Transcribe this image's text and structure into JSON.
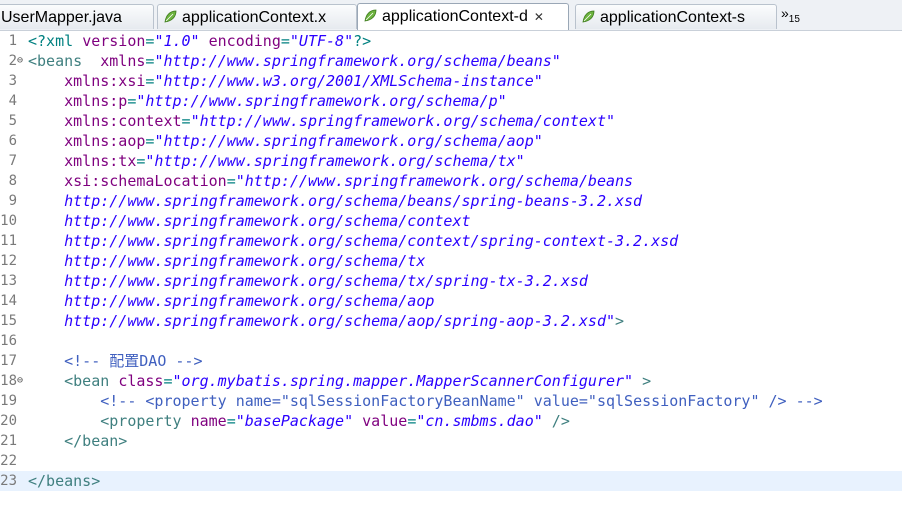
{
  "tabs": [
    {
      "label": "UserMapper.java",
      "icon": "java-file-icon",
      "active": false
    },
    {
      "label": "applicationContext.x",
      "icon": "spring-leaf-icon",
      "active": false
    },
    {
      "label": "applicationContext-d",
      "icon": "spring-leaf-icon",
      "active": true,
      "close": "✕"
    },
    {
      "label": "applicationContext-s",
      "icon": "spring-leaf-icon",
      "active": false
    }
  ],
  "overflow": {
    "glyph": "»",
    "count": "15"
  },
  "lines": [
    {
      "n": "1",
      "fold": "",
      "segs": [
        [
          "p",
          "<?xml "
        ],
        [
          "a",
          "version"
        ],
        [
          "p",
          "="
        ],
        [
          "v",
          "\"1.0\""
        ],
        [
          "p",
          " "
        ],
        [
          "a",
          "encoding"
        ],
        [
          "p",
          "="
        ],
        [
          "v",
          "\"UTF-8\""
        ],
        [
          "p",
          "?>"
        ]
      ]
    },
    {
      "n": "2",
      "fold": "⊖",
      "segs": [
        [
          "t",
          "<beans"
        ],
        [
          "p",
          "  "
        ],
        [
          "a",
          "xmlns"
        ],
        [
          "p",
          "="
        ],
        [
          "v",
          "\"http://www.springframework.org/schema/beans\""
        ]
      ]
    },
    {
      "n": "3",
      "fold": "",
      "segs": [
        [
          "p",
          "    "
        ],
        [
          "a",
          "xmlns:xsi"
        ],
        [
          "p",
          "="
        ],
        [
          "v",
          "\"http://www.w3.org/2001/XMLSchema-instance\""
        ]
      ]
    },
    {
      "n": "4",
      "fold": "",
      "segs": [
        [
          "p",
          "    "
        ],
        [
          "a",
          "xmlns:p"
        ],
        [
          "p",
          "="
        ],
        [
          "v",
          "\"http://www.springframework.org/schema/p\""
        ]
      ]
    },
    {
      "n": "5",
      "fold": "",
      "segs": [
        [
          "p",
          "    "
        ],
        [
          "a",
          "xmlns:context"
        ],
        [
          "p",
          "="
        ],
        [
          "v",
          "\"http://www.springframework.org/schema/context\""
        ]
      ]
    },
    {
      "n": "6",
      "fold": "",
      "segs": [
        [
          "p",
          "    "
        ],
        [
          "a",
          "xmlns:aop"
        ],
        [
          "p",
          "="
        ],
        [
          "v",
          "\"http://www.springframework.org/schema/aop\""
        ]
      ]
    },
    {
      "n": "7",
      "fold": "",
      "segs": [
        [
          "p",
          "    "
        ],
        [
          "a",
          "xmlns:tx"
        ],
        [
          "p",
          "="
        ],
        [
          "v",
          "\"http://www.springframework.org/schema/tx\""
        ]
      ]
    },
    {
      "n": "8",
      "fold": "",
      "segs": [
        [
          "p",
          "    "
        ],
        [
          "a",
          "xsi:schemaLocation"
        ],
        [
          "p",
          "="
        ],
        [
          "v",
          "\"http://www.springframework.org/schema/beans"
        ]
      ]
    },
    {
      "n": "9",
      "fold": "",
      "segs": [
        [
          "v",
          "    http://www.springframework.org/schema/beans/spring-beans-3.2.xsd"
        ]
      ]
    },
    {
      "n": "10",
      "fold": "",
      "segs": [
        [
          "v",
          "    http://www.springframework.org/schema/context"
        ]
      ]
    },
    {
      "n": "11",
      "fold": "",
      "segs": [
        [
          "v",
          "    http://www.springframework.org/schema/context/spring-context-3.2.xsd"
        ]
      ]
    },
    {
      "n": "12",
      "fold": "",
      "segs": [
        [
          "v",
          "    http://www.springframework.org/schema/tx"
        ]
      ]
    },
    {
      "n": "13",
      "fold": "",
      "segs": [
        [
          "v",
          "    http://www.springframework.org/schema/tx/spring-tx-3.2.xsd"
        ]
      ]
    },
    {
      "n": "14",
      "fold": "",
      "segs": [
        [
          "v",
          "    http://www.springframework.org/schema/aop"
        ]
      ]
    },
    {
      "n": "15",
      "fold": "",
      "segs": [
        [
          "v",
          "    http://www.springframework.org/schema/aop/spring-aop-3.2.xsd\""
        ],
        [
          "t",
          ">"
        ]
      ]
    },
    {
      "n": "16",
      "fold": "",
      "segs": []
    },
    {
      "n": "17",
      "fold": "",
      "segs": [
        [
          "p",
          "    "
        ],
        [
          "c",
          "<!-- 配置DAO -->"
        ]
      ]
    },
    {
      "n": "18",
      "fold": "⊖",
      "segs": [
        [
          "p",
          "    "
        ],
        [
          "t",
          "<bean "
        ],
        [
          "a",
          "class"
        ],
        [
          "p",
          "="
        ],
        [
          "v",
          "\"org.mybatis.spring.mapper.MapperScannerConfigurer\""
        ],
        [
          "t",
          " >"
        ]
      ]
    },
    {
      "n": "19",
      "fold": "",
      "segs": [
        [
          "p",
          "        "
        ],
        [
          "c",
          "<!-- <property name=\"sqlSessionFactoryBeanName\" value=\"sqlSessionFactory\" /> -->"
        ]
      ]
    },
    {
      "n": "20",
      "fold": "",
      "segs": [
        [
          "p",
          "        "
        ],
        [
          "t",
          "<property "
        ],
        [
          "a",
          "name"
        ],
        [
          "p",
          "="
        ],
        [
          "v",
          "\"basePackage\""
        ],
        [
          "p",
          " "
        ],
        [
          "a",
          "value"
        ],
        [
          "p",
          "="
        ],
        [
          "v",
          "\"cn.smbms.dao\""
        ],
        [
          "t",
          " />"
        ]
      ]
    },
    {
      "n": "21",
      "fold": "",
      "segs": [
        [
          "p",
          "    "
        ],
        [
          "t",
          "</bean>"
        ]
      ]
    },
    {
      "n": "22",
      "fold": "",
      "segs": []
    },
    {
      "n": "23",
      "fold": "",
      "segs": [
        [
          "t",
          "</beans>"
        ]
      ],
      "current": true
    }
  ],
  "colors": {
    "tag": "#3f7f7f",
    "attr": "#7f007f",
    "value": "#2a00ff",
    "comment": "#3f5fbf",
    "current_line": "#e8f2fe"
  }
}
